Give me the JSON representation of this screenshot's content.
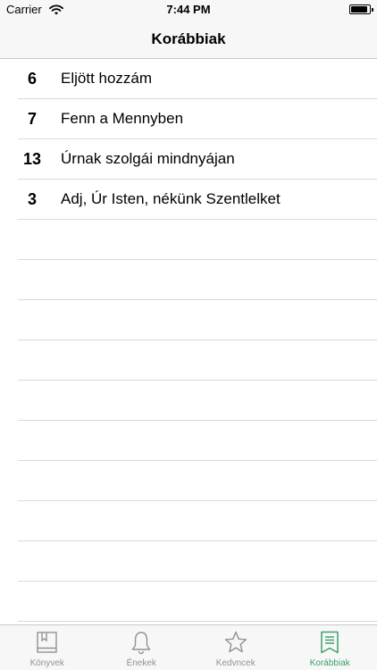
{
  "status_bar": {
    "carrier": "Carrier",
    "time": "7:44 PM"
  },
  "nav": {
    "title": "Korábbiak"
  },
  "rows": [
    {
      "number": "6",
      "title": "Eljött hozzám"
    },
    {
      "number": "7",
      "title": "Fenn a Mennyben"
    },
    {
      "number": "13",
      "title": "Úrnak szolgái mindnyájan"
    },
    {
      "number": "3",
      "title": "Adj, Úr Isten, nékünk Szentlelket"
    }
  ],
  "empty_rows": 10,
  "tab_bar": {
    "active": "korabbiak",
    "tabs": [
      {
        "id": "konyvek",
        "label": "Könyvek",
        "icon": "book-icon"
      },
      {
        "id": "enekek",
        "label": "Énekek",
        "icon": "bell-icon"
      },
      {
        "id": "kedvncek",
        "label": "Kedvncek",
        "icon": "star-icon"
      },
      {
        "id": "korabbiak",
        "label": "Korábbiak",
        "icon": "bookmark-list-icon"
      }
    ]
  },
  "colors": {
    "accent": "#3da06c",
    "inactive": "#929292",
    "separator": "#d9d9de",
    "bar_background": "#f7f7f7"
  }
}
